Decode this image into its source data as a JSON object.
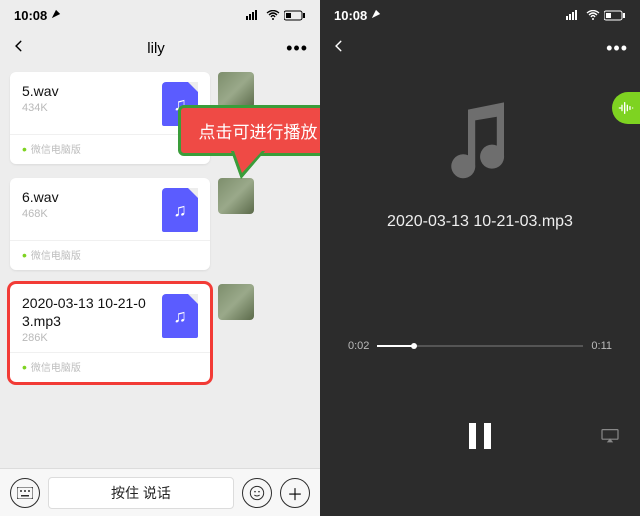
{
  "status": {
    "time": "10:08"
  },
  "left": {
    "title": "lily",
    "messages": [
      {
        "name": "5.wav",
        "size": "434K",
        "source": "微信电脑版"
      },
      {
        "name": "6.wav",
        "size": "468K",
        "source": "微信电脑版"
      },
      {
        "name": "2020-03-13 10-21-03.mp3",
        "size": "286K",
        "source": "微信电脑版"
      }
    ],
    "talk": "按住 说话"
  },
  "tip": "点击可进行播放",
  "right": {
    "track": "2020-03-13 10-21-03.mp3",
    "elapsed": "0:02",
    "total": "0:11"
  }
}
